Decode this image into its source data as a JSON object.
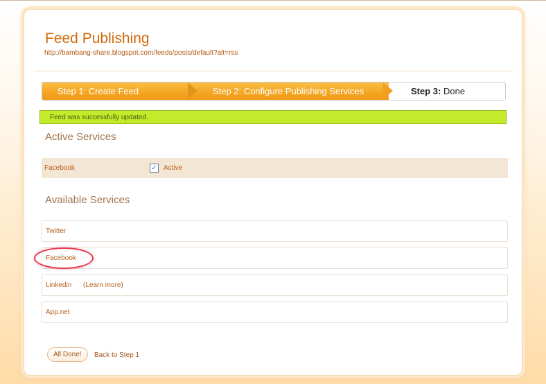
{
  "header": {
    "title": "Feed Publishing",
    "feed_url": "http://bambang-share.blogspot.com/feeds/posts/default?alt=rss"
  },
  "wizard": {
    "step1": "Step 1: Create Feed",
    "step2": "Step 2: Configure Publishing Services",
    "step3_prefix": "Step 3:",
    "step3_label": "Done",
    "current_step": 3
  },
  "alert": {
    "message": "Feed was successfully updated."
  },
  "active_services": {
    "title": "Active Services",
    "items": [
      {
        "name": "Facebook",
        "status_label": "Active",
        "checked": true
      }
    ]
  },
  "available_services": {
    "title": "Available Services",
    "items": [
      {
        "name": "Twitter"
      },
      {
        "name": "Facebook",
        "highlighted": true
      },
      {
        "name": "Linkedin",
        "extra_link": "(Learn more)"
      },
      {
        "name": "App.net"
      }
    ]
  },
  "actions": {
    "all_done_label": "All Done!",
    "back_label": "Back to Step 1"
  },
  "colors": {
    "accent": "#d26a0c",
    "step_active": "#f5a623",
    "alert_bg": "#c3ea2b",
    "highlight_ring": "#e8394f",
    "active_row_bg": "#f3e6d5"
  },
  "icons": {
    "checkbox": "checkbox-checked-icon"
  }
}
